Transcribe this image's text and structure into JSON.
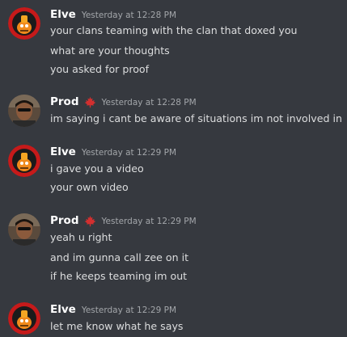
{
  "messages": [
    {
      "author": "Elve",
      "avatar": "orange-robot-avatar",
      "timestamp": "Yesterday at 12:28 PM",
      "lines": [
        "your clans teaming with the clan that doxed you",
        "what are your thoughts",
        "you asked for proof"
      ]
    },
    {
      "author": "Prod",
      "avatar": "person-photo-avatar",
      "badge": "maple-leaf-icon",
      "badge_color": "#d32f2f",
      "timestamp": "Yesterday at 12:28 PM",
      "lines": [
        "im saying i cant be aware of situations im not involved in"
      ]
    },
    {
      "author": "Elve",
      "avatar": "orange-robot-avatar",
      "timestamp": "Yesterday at 12:29 PM",
      "lines": [
        "i gave you a video",
        "your own video"
      ]
    },
    {
      "author": "Prod",
      "avatar": "person-photo-avatar",
      "badge": "maple-leaf-icon",
      "badge_color": "#d32f2f",
      "timestamp": "Yesterday at 12:29 PM",
      "lines": [
        "yeah u right",
        "and im gunna call zee on it",
        "if he keeps teaming im out"
      ]
    },
    {
      "author": "Elve",
      "avatar": "orange-robot-avatar",
      "timestamp": "Yesterday at 12:29 PM",
      "lines": [
        "let me know what he says"
      ]
    }
  ],
  "colors": {
    "background": "#36393f",
    "username": "#ffffff",
    "timestamp": "#a3a6aa",
    "message_text": "#dcddde"
  }
}
